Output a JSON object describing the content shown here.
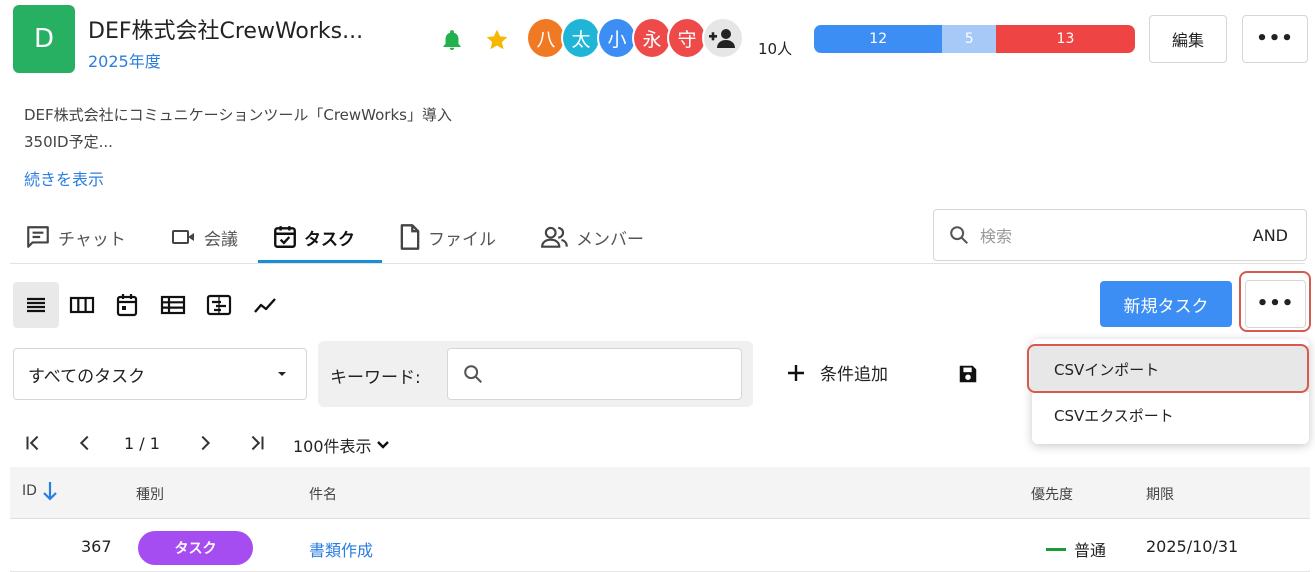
{
  "project": {
    "icon_letter": "D",
    "icon_color": "#27b061",
    "title": "DEF株式会社CrewWorks...",
    "year": "2025年度",
    "member_count": "10人",
    "avatars": [
      {
        "char": "八",
        "color": "#f07a24"
      },
      {
        "char": "太",
        "color": "#1fb5d6"
      },
      {
        "char": "小",
        "color": "#3d8ef4"
      },
      {
        "char": "永",
        "color": "#ee4a4a"
      },
      {
        "char": "守",
        "color": "#ee4a4a"
      }
    ],
    "progress": [
      {
        "value": "12",
        "color": "#3d8ef4"
      },
      {
        "value": "5",
        "color": "#a7c9f7"
      },
      {
        "value": "13",
        "color": "#ef4444"
      }
    ],
    "edit_label": "編集",
    "description_line1": "DEF株式会社にコミュニケーションツール「CrewWorks」導入",
    "description_line2": "350ID予定...",
    "read_more": "続きを表示"
  },
  "tabs": [
    {
      "label": "チャット",
      "icon": "chat-icon"
    },
    {
      "label": "会議",
      "icon": "video-icon"
    },
    {
      "label": "タスク",
      "icon": "task-calendar-icon",
      "active": true
    },
    {
      "label": "ファイル",
      "icon": "file-icon"
    },
    {
      "label": "メンバー",
      "icon": "members-icon"
    }
  ],
  "search": {
    "placeholder": "検索",
    "mode": "AND"
  },
  "toolbar": {
    "views": [
      "list-view-icon",
      "board-view-icon",
      "calendar-view-icon",
      "table-view-icon",
      "gantt-view-icon",
      "chart-view-icon"
    ],
    "new_task_label": "新規タスク"
  },
  "filter": {
    "selected": "すべてのタスク",
    "keyword_label": "キーワード:",
    "add_condition": "条件追加"
  },
  "menu": {
    "items": [
      "CSVインポート",
      "CSVエクスポート"
    ]
  },
  "pager": {
    "page": "1 / 1",
    "per_page": "100件表示"
  },
  "table": {
    "columns": [
      "ID",
      "種別",
      "件名",
      "優先度",
      "期限"
    ],
    "rows": [
      {
        "id": "367",
        "type": "タスク",
        "title": "書類作成",
        "priority": "普通",
        "due": "2025/10/31"
      }
    ]
  },
  "colors": {
    "accent": "#3d8ef4",
    "highlight": "#d65a4d",
    "tab_underline": "#1a8fd6"
  }
}
